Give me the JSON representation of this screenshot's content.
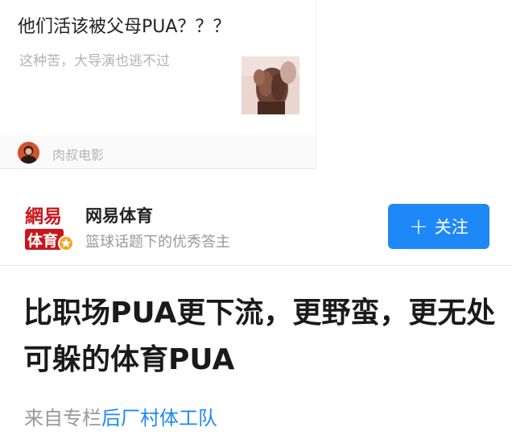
{
  "feed_card": {
    "title": "他们活该被父母PUA？？？",
    "subtitle": "这种苦，大导演也逃不过",
    "author": "肉叔电影",
    "thumbnail_icon": "clasped-hands-photo"
  },
  "profile": {
    "logo_text_top": "網易",
    "logo_text_bottom": "体育",
    "name": "网易体育",
    "description": "篮球话题下的优秀答主",
    "follow_label": "关注",
    "follow_icon": "plus-icon",
    "accent_color": "#1e88f7",
    "logo_color": "#c8161d",
    "badge_color": "#f5a623"
  },
  "article": {
    "title": "比职场PUA更下流，更野蛮，更无处可躲的体育PUA",
    "column_prefix": "来自专栏",
    "column_name": "后厂村体工队"
  }
}
